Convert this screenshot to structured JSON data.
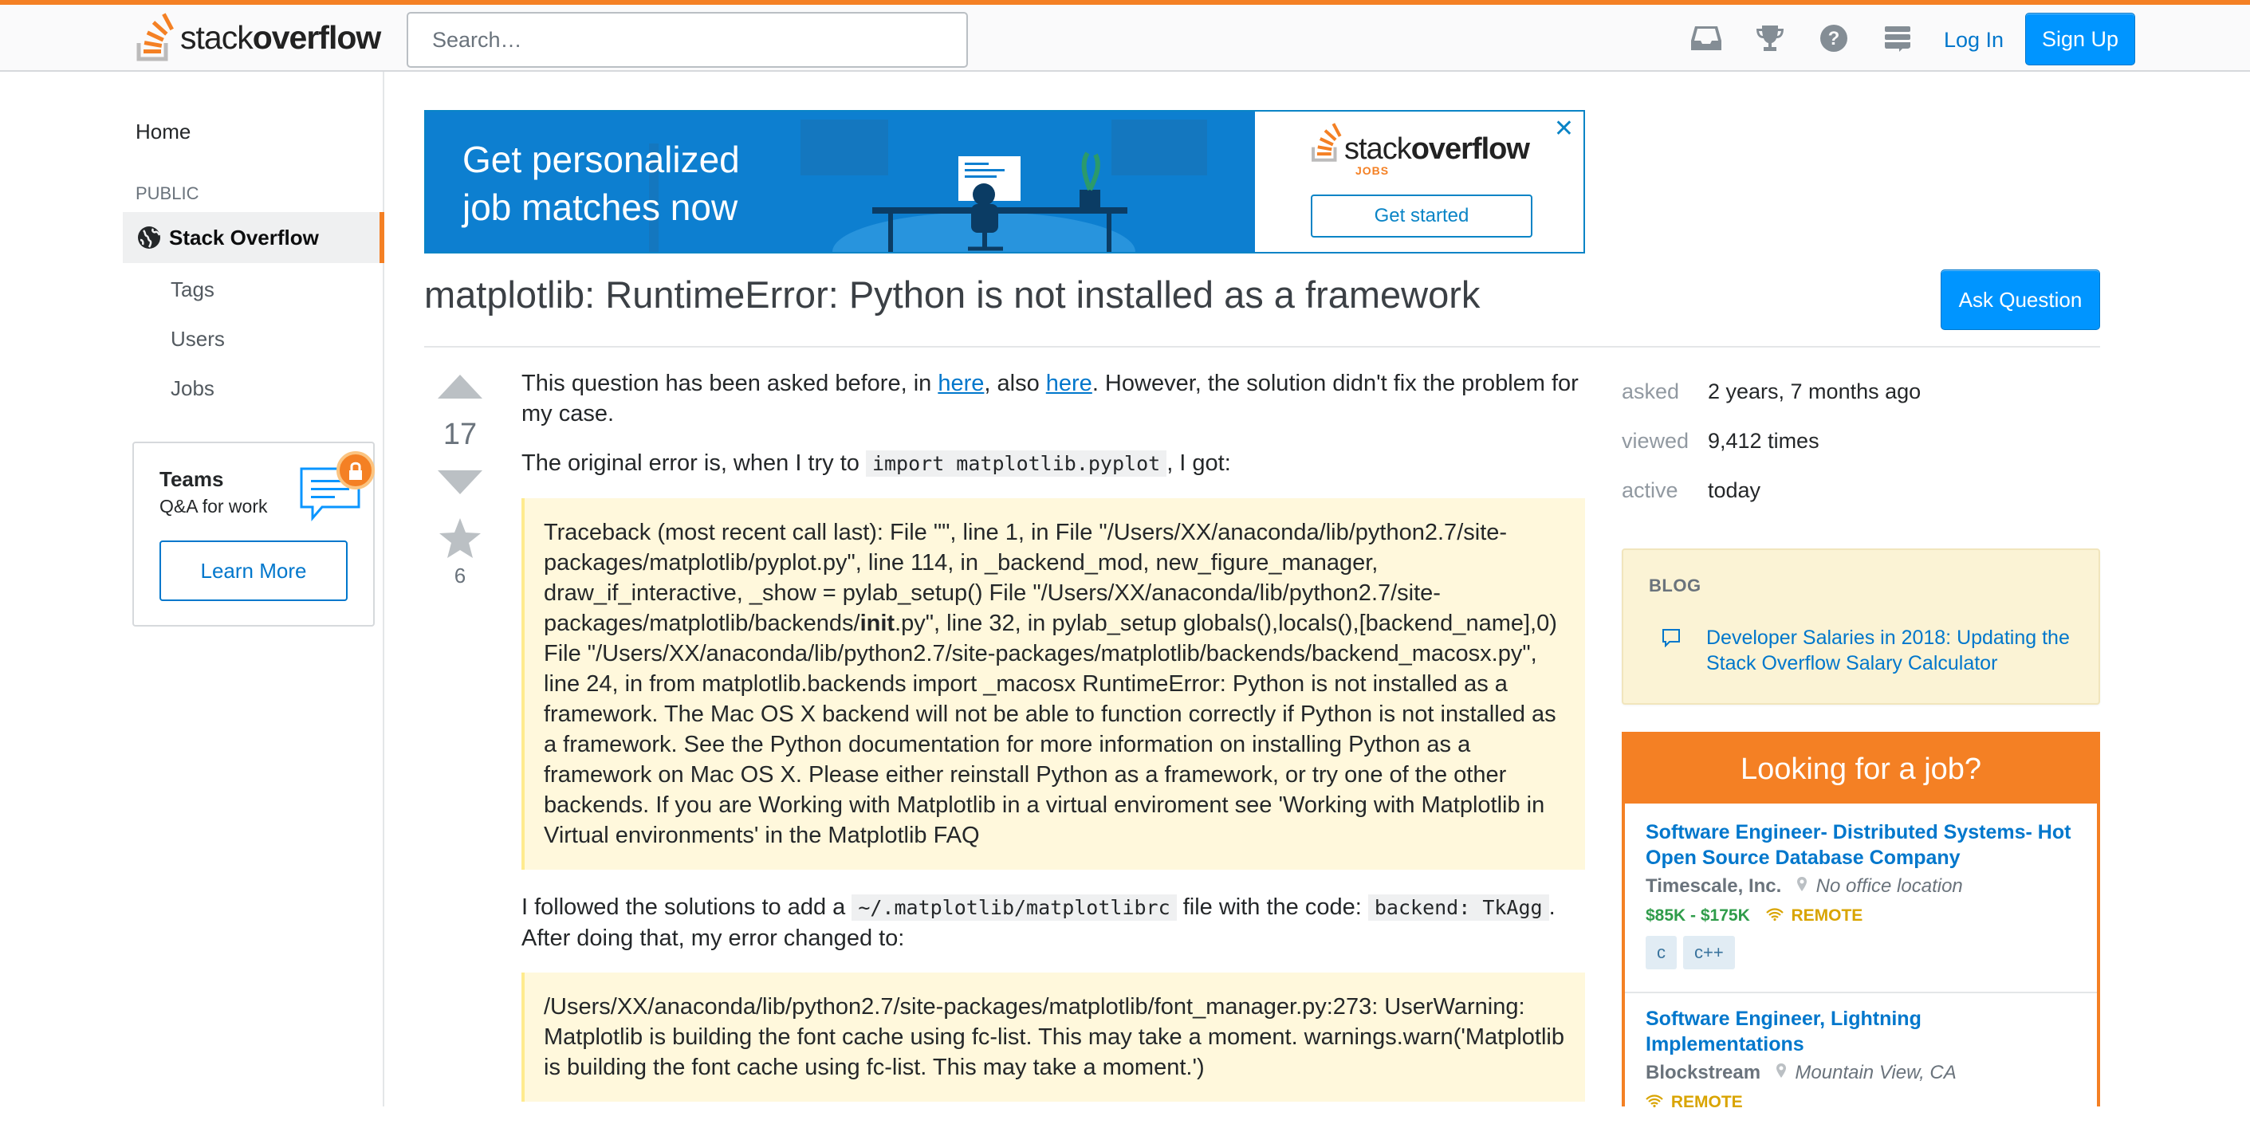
{
  "header": {
    "logo_light": "stack",
    "logo_bold": "overflow",
    "search_placeholder": "Search…",
    "login": "Log In",
    "signup": "Sign Up",
    "icons": [
      "inbox-icon",
      "trophy-icon",
      "help-icon",
      "site-switcher-icon"
    ]
  },
  "sidebar": {
    "home": "Home",
    "public": "PUBLIC",
    "stack_overflow": "Stack Overflow",
    "tags": "Tags",
    "users": "Users",
    "jobs": "Jobs",
    "teams_title": "Teams",
    "teams_sub": "Q&A for work",
    "learn_more": "Learn More"
  },
  "ad": {
    "line1": "Get personalized",
    "line2": "job matches now",
    "logo_light": "stack",
    "logo_bold": "overflow",
    "jobs_label": "JOBS",
    "cta": "Get started",
    "close": "✕"
  },
  "question": {
    "title": "matplotlib: RuntimeError: Python is not installed as a framework",
    "ask_button": "Ask Question",
    "votes": "17",
    "favorites": "6",
    "p1_a": "This question has been asked before, in ",
    "p1_link1": "here",
    "p1_b": ", also ",
    "p1_link2": "here",
    "p1_c": ". However, the solution didn't fix the problem for my case.",
    "p2_a": "The original error is, when I try to ",
    "p2_code": "import matplotlib.pyplot",
    "p2_b": ", I got:",
    "quote1_a": "Traceback (most recent call last): File \"\", line 1, in File \"/Users/XX/anaconda/lib/python2.7/site-packages/matplotlib/pyplot.py\", line 114, in _backend_mod, new_figure_manager, draw_if_interactive, _show = pylab_setup() File \"/Users/XX/anaconda/lib/python2.7/site-packages/matplotlib/backends/",
    "quote1_bold": "init",
    "quote1_b": ".py\", line 32, in pylab_setup globals(),locals(),[backend_name],0) File \"/Users/XX/anaconda/lib/python2.7/site-packages/matplotlib/backends/backend_macosx.py\", line 24, in from matplotlib.backends import _macosx RuntimeError: Python is not installed as a framework. The Mac OS X backend will not be able to function correctly if Python is not installed as a framework. See the Python documentation for more information on installing Python as a framework on Mac OS X. Please either reinstall Python as a framework, or try one of the other backends. If you are Working with Matplotlib in a virtual enviroment see 'Working with Matplotlib in Virtual environments' in the Matplotlib FAQ",
    "p3_a": "I followed the solutions to add a ",
    "p3_code1": "~/.matplotlib/matplotlibrc",
    "p3_b": " file with the code: ",
    "p3_code2": "backend: TkAgg",
    "p3_c": ". After doing that, my error changed to:",
    "quote2": "/Users/XX/anaconda/lib/python2.7/site-packages/matplotlib/font_manager.py:273: UserWarning: Matplotlib is building the font cache using fc-list. This may take a moment. warnings.warn('Matplotlib is building the font cache using fc-list. This may take a moment.')"
  },
  "stats": {
    "asked_label": "asked",
    "asked_value": "2 years, 7 months ago",
    "viewed_label": "viewed",
    "viewed_value": "9,412 times",
    "active_label": "active",
    "active_value": "today"
  },
  "blog": {
    "heading": "BLOG",
    "link": "Developer Salaries in 2018: Updating the Stack Overflow Salary Calculator"
  },
  "jobs": {
    "heading": "Looking for a job?",
    "items": [
      {
        "title": "Software Engineer- Distributed Systems- Hot Open Source Database Company",
        "company": "Timescale, Inc.",
        "location": "No office location",
        "salary": "$85K - $175K",
        "remote": "REMOTE",
        "tags": [
          "c",
          "c++"
        ]
      },
      {
        "title": "Software Engineer, Lightning Implementations",
        "company": "Blockstream",
        "location": "Mountain View, CA",
        "remote": "REMOTE"
      }
    ]
  },
  "colors": {
    "brand_orange": "#f48024",
    "link_blue": "#0077cc",
    "button_blue": "#0095ff",
    "quote_bg": "#fff8dc"
  }
}
